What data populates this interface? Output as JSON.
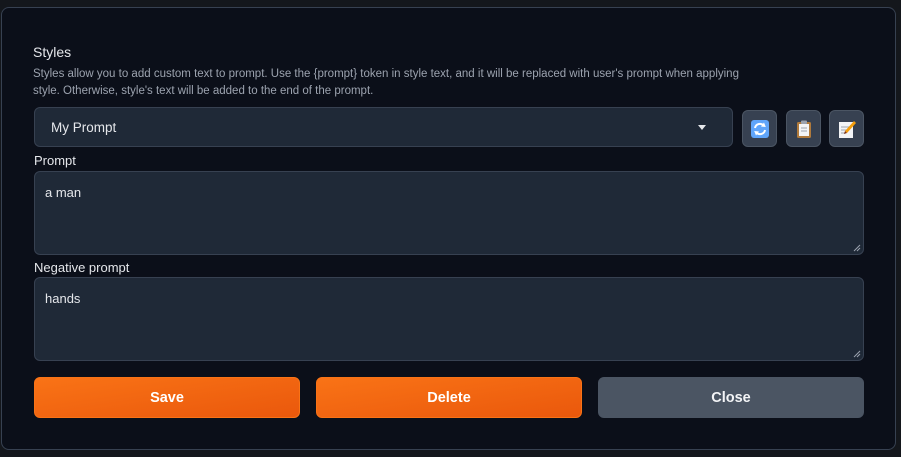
{
  "styles_modal": {
    "title": "Styles",
    "description": "Styles allow you to add custom text to prompt. Use the {prompt} token in style text, and it will be replaced with user's prompt when applying style. Otherwise, style's text will be added to the end of the prompt.",
    "selected_style": "My Prompt",
    "icon_buttons": [
      "refresh-icon",
      "clipboard-icon",
      "edit-icon"
    ],
    "prompt_label": "Prompt",
    "prompt_value": "a man",
    "negative_label": "Negative prompt",
    "negative_value": "hands",
    "save_label": "Save",
    "delete_label": "Delete",
    "close_label": "Close",
    "colors": {
      "accent": "#f97316",
      "background": "#0b0f19",
      "input": "#1f2937",
      "secondary_button": "#4b5563"
    }
  }
}
